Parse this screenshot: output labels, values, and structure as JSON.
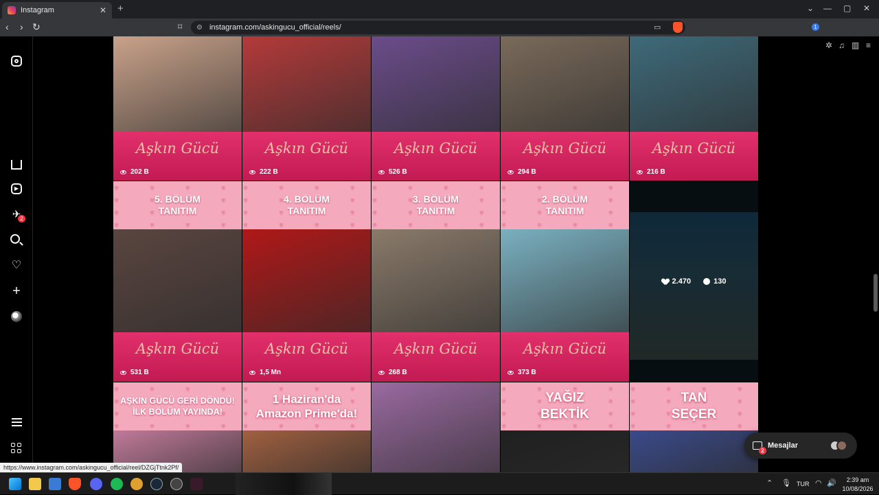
{
  "browser": {
    "tab_title": "Instagram",
    "tab_close": "✕",
    "new_tab": "+",
    "url": "instagram.com/askingucu_official/reels/",
    "window_controls": [
      "⌄",
      "—",
      "▢",
      "✕"
    ],
    "status_url": "https://www.instagram.com/askingucu_official/reel/DZGjTtnk2Pf/"
  },
  "sidebar": {
    "notifications_badge": "2"
  },
  "reels": [
    {
      "views": "202 B",
      "photo_color": "#c9a28a"
    },
    {
      "views": "222 B",
      "photo_color": "#b43a3a"
    },
    {
      "views": "526 B",
      "photo_color": "#6b4c8a"
    },
    {
      "views": "294 B",
      "photo_color": "#7a6a5a"
    },
    {
      "views": "216 B",
      "photo_color": "#3e6a7a"
    },
    {
      "banner": "5. BÖLÜM\nTANITIM",
      "views": "531 B",
      "photo_color": "#5a4540"
    },
    {
      "banner": "4. BÖLÜM\nTANITIM",
      "views": "1,5 Mn",
      "photo_color": "#b01818"
    },
    {
      "banner": "3. BÖLÜM\nTANITIM",
      "views": "268 B",
      "photo_color": "#8a7a6a"
    },
    {
      "banner": "2. BÖLÜM\nTANITIM",
      "views": "373 B",
      "photo_color": "#7ab0c0"
    },
    {
      "banner": "AŞKIN GÜCÜ GERİ DÖNDÜ!\nİLK BÖLÜM YAYINDA!",
      "photo_color": "#c07a9a"
    },
    {
      "banner": "1 Haziran'da\nAmazon Prime'da!",
      "photo_color": "#a06040"
    },
    {
      "photo_color": "#9a6aa0"
    },
    {
      "banner": "YAĞIZ\nBEKTİK",
      "photo_color": "#202020"
    },
    {
      "banner": "TAN\nSEÇER",
      "photo_color": "#3a4a8a"
    }
  ],
  "logo_text": "Aşkın Gücü",
  "hover_reel": {
    "likes": "2.470",
    "comments": "130"
  },
  "messages": {
    "label": "Mesajlar",
    "badge": "2"
  },
  "taskbar": {
    "language": "TUR",
    "time": "2:39 am",
    "date": "10/08/2026"
  }
}
